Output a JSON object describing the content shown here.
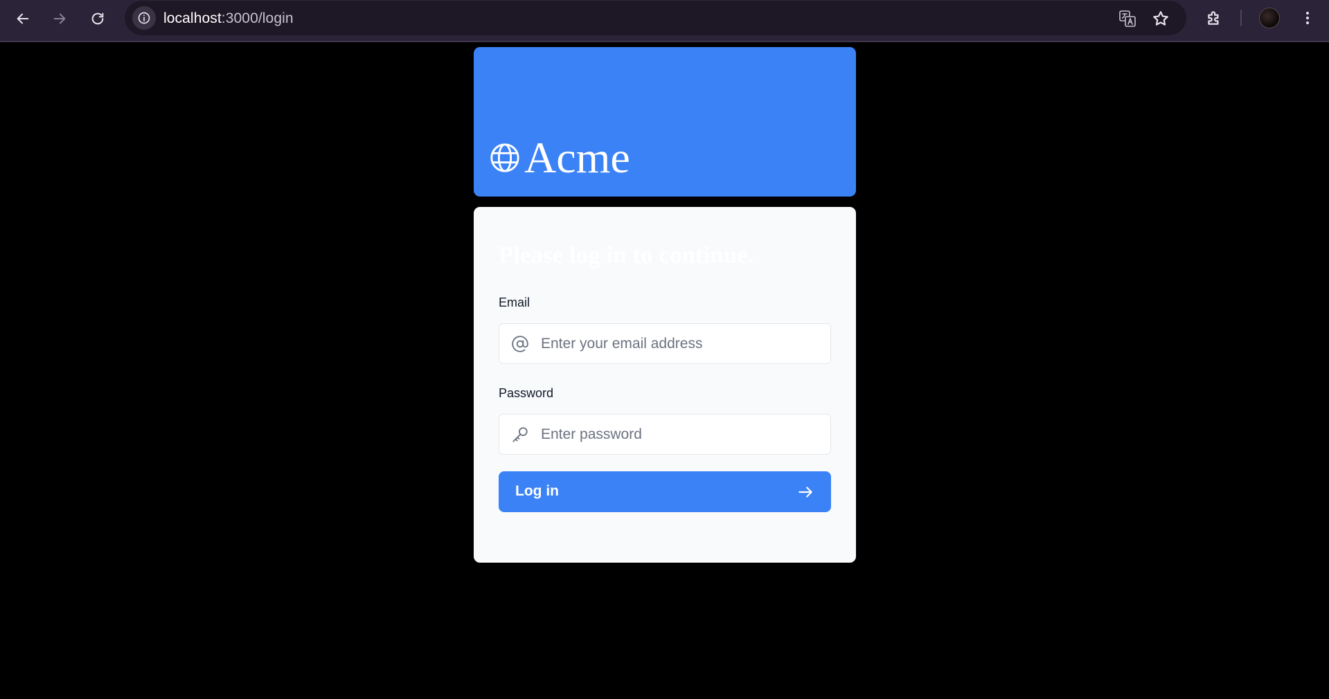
{
  "browser": {
    "url_host": "localhost",
    "url_path": ":3000/login",
    "icons": {
      "back": "arrow-left-icon",
      "forward": "arrow-right-icon",
      "reload": "reload-icon",
      "site_info": "info-icon",
      "translate": "translate-icon",
      "bookmark": "star-icon",
      "extensions": "puzzle-icon",
      "profile": "avatar",
      "menu": "kebab-menu-icon"
    }
  },
  "header": {
    "brand_name": "Acme",
    "brand_icon": "globe-icon",
    "background_color": "#3b82f6"
  },
  "login_form": {
    "title": "Please log in to continue.",
    "email": {
      "label": "Email",
      "value": "",
      "placeholder": "Enter your email address",
      "icon": "at-sign-icon"
    },
    "password": {
      "label": "Password",
      "value": "",
      "placeholder": "Enter password",
      "icon": "key-icon"
    },
    "submit": {
      "label": "Log in",
      "icon": "arrow-right-icon"
    }
  },
  "colors": {
    "accent": "#3b82f6",
    "page_background": "#000000",
    "card_background": "#f8fafc"
  }
}
